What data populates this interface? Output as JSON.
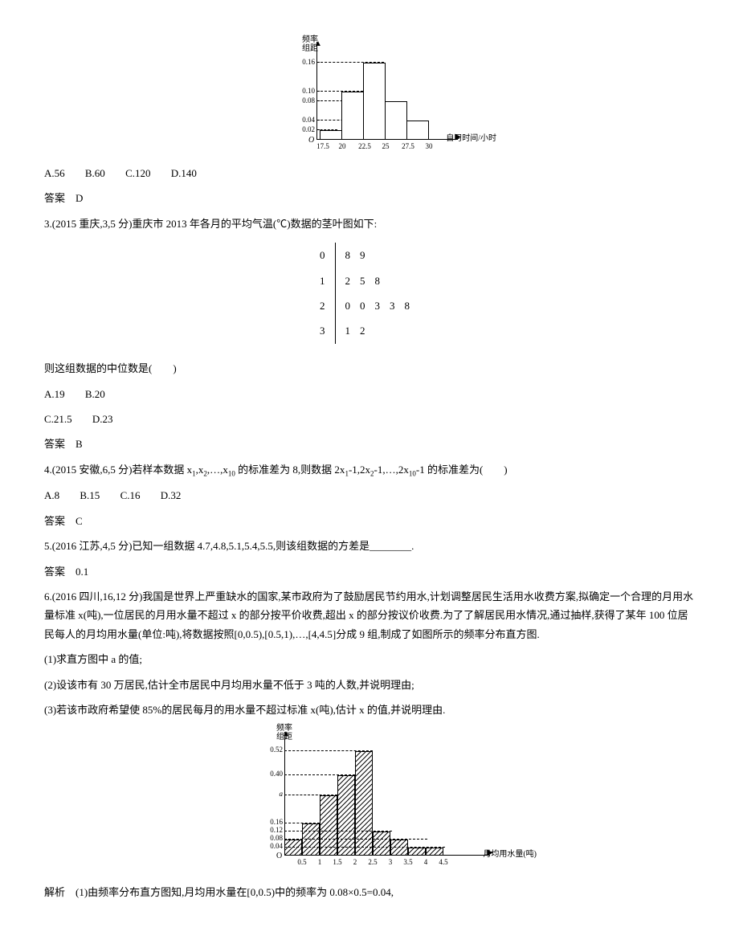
{
  "chart_data": [
    {
      "id": "hist1",
      "type": "bar",
      "title": "",
      "ylabel": "频率/组距",
      "xlabel": "自习时间/小时",
      "origin": "O",
      "x_ticks": [
        "17.5",
        "20",
        "22.5",
        "25",
        "27.5",
        "30"
      ],
      "y_ticks": [
        "0.02",
        "0.04",
        "0.08",
        "0.10",
        "0.16"
      ],
      "values": [
        0.02,
        0.1,
        0.16,
        0.08,
        0.04
      ]
    },
    {
      "id": "stemleaf",
      "type": "table",
      "rows": [
        {
          "stem": "0",
          "leaves": "89"
        },
        {
          "stem": "1",
          "leaves": "258"
        },
        {
          "stem": "2",
          "leaves": "00338"
        },
        {
          "stem": "3",
          "leaves": "12"
        }
      ]
    },
    {
      "id": "hist2",
      "type": "bar",
      "ylabel": "频率/组距",
      "xlabel": "月均用水量(吨)",
      "origin": "O",
      "x_ticks": [
        "0.5",
        "1",
        "1.5",
        "2",
        "2.5",
        "3",
        "3.5",
        "4",
        "4.5"
      ],
      "y_ticks": [
        "0.04",
        "0.08",
        "0.12",
        "0.16",
        "0.40",
        "0.52",
        "a"
      ],
      "values": [
        0.08,
        0.16,
        "a",
        0.4,
        0.52,
        0.12,
        0.08,
        0.04,
        0.04
      ]
    }
  ],
  "q2": {
    "options": {
      "a": "A.56",
      "b": "B.60",
      "c": "C.120",
      "d": "D.140"
    },
    "ans_label": "答案　D"
  },
  "q3": {
    "stem": "3.(2015 重庆,3,5 分)重庆市 2013 年各月的平均气温(℃)数据的茎叶图如下:",
    "prompt": "则这组数据的中位数是(　　)",
    "opts1": {
      "a": "A.19",
      "b": "B.20"
    },
    "opts2": {
      "c": "C.21.5",
      "d": "D.23"
    },
    "ans_label": "答案　B"
  },
  "q4": {
    "stem_pre": "4.(2015 安徽,6,5 分)若样本数据 x",
    "stem_mid": ",x",
    "stem_post": ",…,x",
    "stem_end1": " 的标准差为 8,则数据 2x",
    "stem_end2": "-1,2x",
    "stem_end3": "-1,…,2x",
    "stem_end4": "-1 的标准差为(　　)",
    "options": {
      "a": "A.8",
      "b": "B.15",
      "c": "C.16",
      "d": "D.32"
    },
    "ans_label": "答案　C"
  },
  "q5": {
    "stem": "5.(2016 江苏,4,5 分)已知一组数据 4.7,4.8,5.1,5.4,5.5,则该组数据的方差是________.",
    "ans_label": "答案　0.1"
  },
  "q6": {
    "stem": "6.(2016 四川,16,12 分)我国是世界上严重缺水的国家,某市政府为了鼓励居民节约用水,计划调整居民生活用水收费方案,拟确定一个合理的月用水量标准 x(吨),一位居民的月用水量不超过 x 的部分按平价收费,超出 x 的部分按议价收费.为了了解居民用水情况,通过抽样,获得了某年 100 位居民每人的月均用水量(单位:吨),将数据按照[0,0.5),[0.5,1),…,[4,4.5]分成 9 组,制成了如图所示的频率分布直方图.",
    "p1": "(1)求直方图中 a 的值;",
    "p2": "(2)设该市有 30 万居民,估计全市居民中月均用水量不低于 3 吨的人数,并说明理由;",
    "p3": "(3)若该市政府希望使 85%的居民每月的用水量不超过标准 x(吨),估计 x 的值,并说明理由.",
    "sol": "解析　(1)由频率分布直方图知,月均用水量在[0,0.5)中的频率为 0.08×0.5=0.04,"
  },
  "labels": {
    "hist1_ylabel": "频率\n组距",
    "hist1_xlabel": "自习时间/小时",
    "hist2_ylabel": "频率\n组距",
    "hist2_xlabel": "月均用水量(吨)"
  }
}
